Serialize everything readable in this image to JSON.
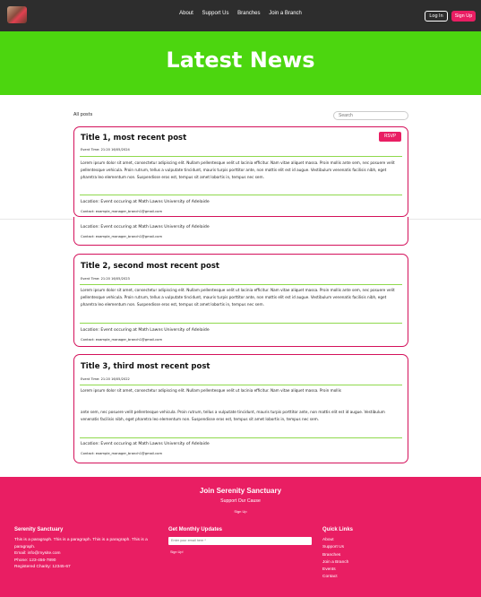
{
  "nav": {
    "links": [
      "About",
      "Support Us",
      "Branches",
      "Join a Branch"
    ],
    "login": "Log In",
    "signup": "Sign Up"
  },
  "hero": {
    "title": "Latest News"
  },
  "toolbar": {
    "all_posts": "All posts",
    "search_placeholder": "Search"
  },
  "posts": [
    {
      "title": "Title 1, most recent post",
      "time": "Event Time: 21:20 16/05/2024",
      "rsvp": "RSVP",
      "body": "Lorem ipsum dolor sit amet, consectetur adipiscing elit. Nullam pellentesque velit ut lacinia efficitur. Nam vitae aliquet massa. Proin mollis ante sem, nec posuere velit pellentesque vehicula. Proin rutrum, tellus a vulputate tincidunt, mauris turpis porttitor ante, non mattis elit est id augue. Vestibulum venenatis facilisis nibh, eget pharetra leo elementum non. Suspendisse eros est, tempus sit amet lobortis in, tempus nec sem.",
      "location": "Location: Event occuring at Math Lawns University of Adelaide",
      "contact": "Contact: example_manager_branch1@gmail.com"
    },
    {
      "title": "Title 2, second most recent post",
      "time": "Event Time: 21:20 16/05/2023",
      "body": "Lorem ipsum dolor sit amet, consectetur adipiscing elit. Nullam pellentesque velit ut lacinia efficitur. Nam vitae aliquet massa. Proin mollis ante sem, nec posuere velit pellentesque vehicula. Proin rutrum, tellus a vulputate tincidunt, mauris turpis porttitor ante, non mattis elit est id augue. Vestibulum venenatis facilisis nibh, eget pharetra leo elementum non. Suspendisse eros est, tempus sit amet lobortis in, tempus nec sem.",
      "location": "Location: Event occuring at Math Lawns University of Adelaide",
      "contact": "Contact: example_manager_branch1@gmail.com"
    },
    {
      "title": "Title 3, third most recent post",
      "time": "Event Time: 21:20 16/05/2022",
      "body_a": "Lorem ipsum dolor sit amet, consectetur adipiscing elit. Nullam pellentesque velit ut lacinia efficitur. Nam vitae aliquet massa. Proin mollis",
      "body_b": "ante sem, nec posuere velit pellentesque vehicula. Proin rutrum, tellus a vulputate tincidunt, mauris turpis porttitor ante, non mattis elit est id augue. Vestibulum venenatis facilisis nibh, eget pharetra leo elementum non. Suspendisse eros est, tempus sit amet lobortis in, tempus nec sem.",
      "location": "Location: Event occuring at Math Lawns University of Adelaide",
      "contact": "Contact: example_manager_branch1@gmail.com"
    }
  ],
  "footer": {
    "join_title": "Join Serenity Sanctuary",
    "support": "Support Our Cause",
    "signup": "Sign Up",
    "about": {
      "title": "Serenity Sanctuary",
      "text": "This is a paragraph. This is a paragraph. This is a paragraph. This is a paragraph.",
      "email": "Email: info@mysite.com",
      "phone": "Phone: 123-456-7890",
      "charity": "Registered Charity: 12345-67"
    },
    "updates": {
      "title": "Get Monthly Updates",
      "placeholder": "Enter your email here *",
      "button": "Sign Up!"
    },
    "quick": {
      "title": "Quick Links",
      "links": [
        "About",
        "Support Us",
        "Branches",
        "Join a Branch",
        "Events",
        "Contact"
      ]
    }
  },
  "colors": {
    "accent": "#e91e63",
    "hero": "#4cd60f",
    "nav": "#2d2d2d",
    "divider": "#8fd94d"
  }
}
